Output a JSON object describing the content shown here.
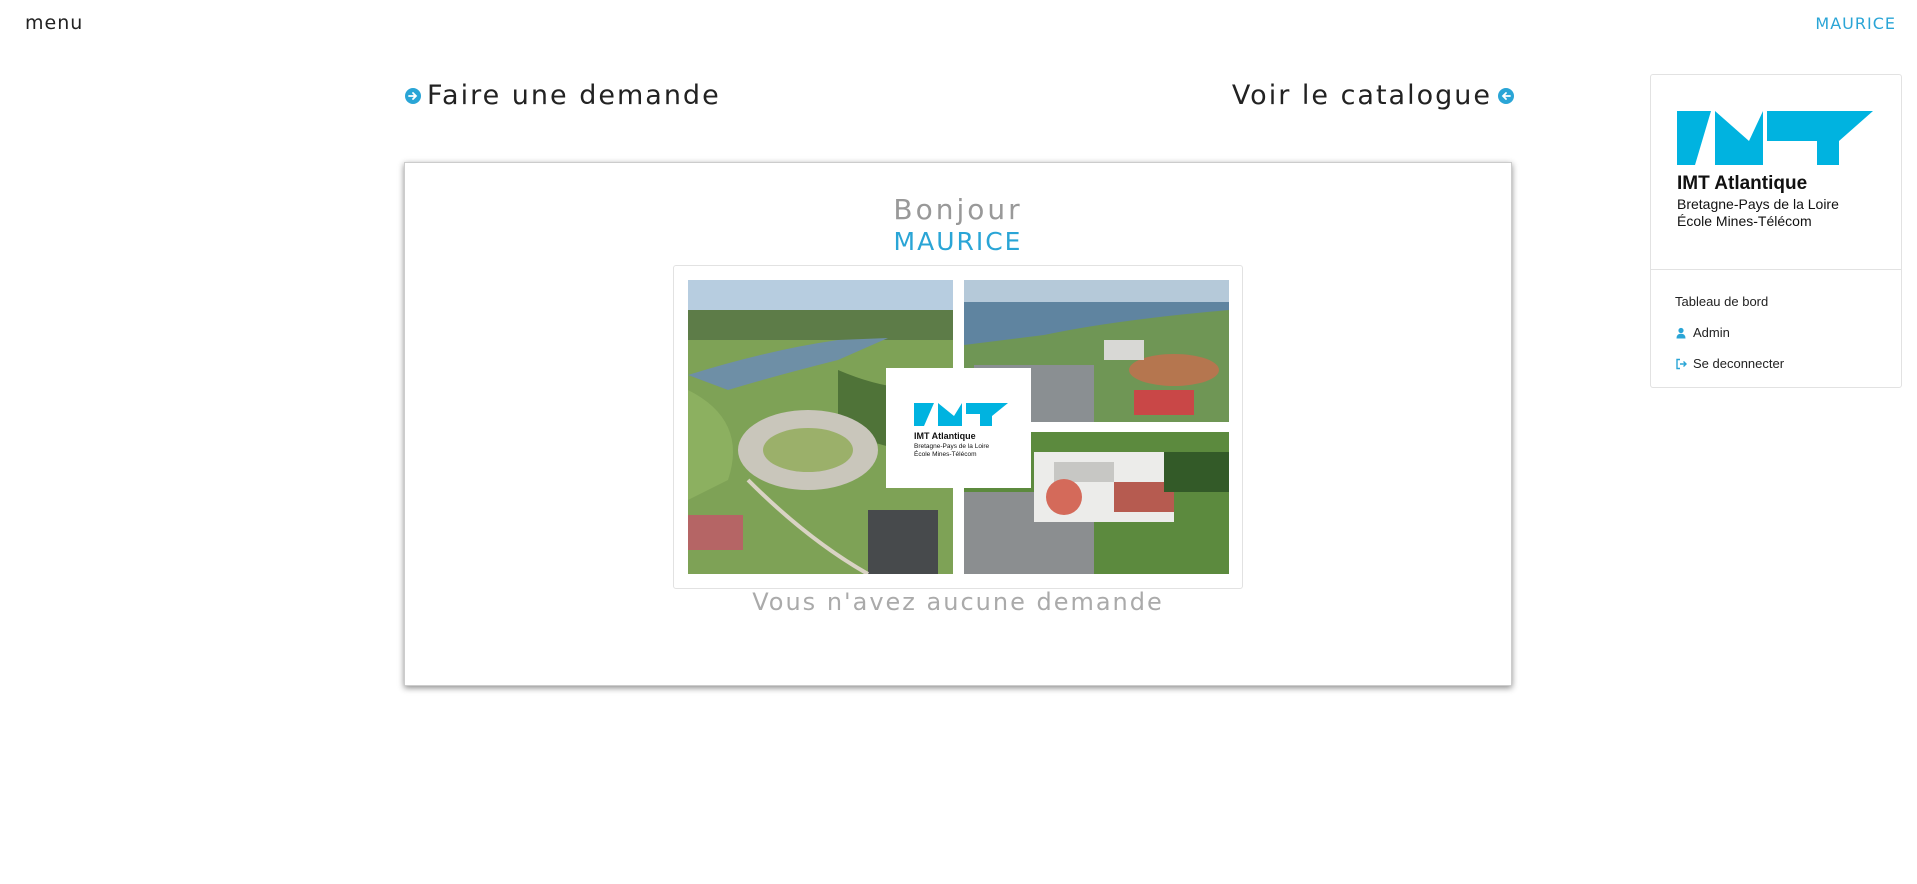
{
  "header": {
    "menu_label": "menu",
    "user_name": "MAURICE"
  },
  "actions": {
    "request_label": "Faire une demande",
    "catalog_label": "Voir le catalogue"
  },
  "welcome": {
    "greeting": "Bonjour",
    "name": "MAURICE",
    "status": "Vous n'avez aucune demande"
  },
  "brand": {
    "name": "IMT Atlantique",
    "line1": "Bretagne-Pays de la Loire",
    "line2": "École Mines-Télécom"
  },
  "sidebar": {
    "items": [
      {
        "label": "Tableau de bord",
        "icon": ""
      },
      {
        "label": "Admin",
        "icon": "user-icon"
      },
      {
        "label": "Se deconnecter",
        "icon": "sign-out-icon"
      }
    ]
  },
  "colors": {
    "accent": "#2aa5d6",
    "logo_cyan": "#00b3e0"
  }
}
